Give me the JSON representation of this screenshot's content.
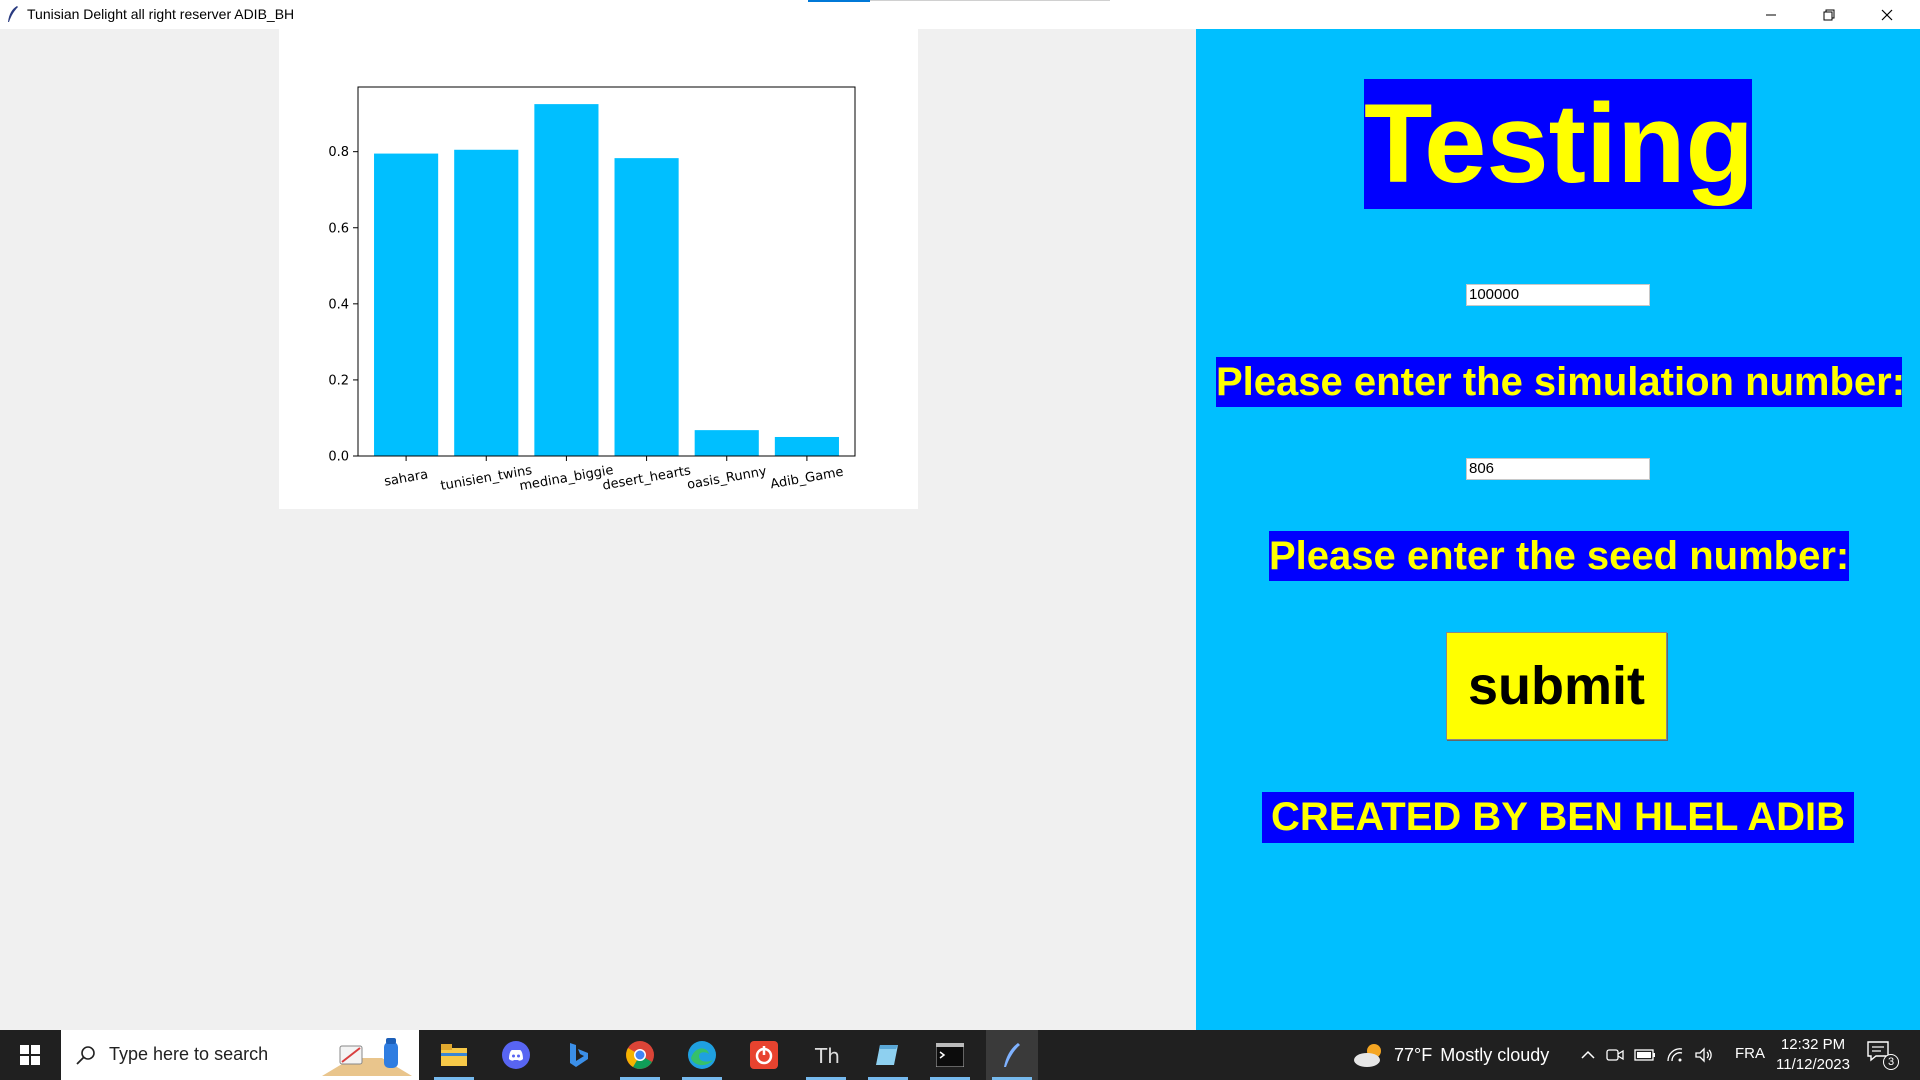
{
  "window": {
    "title": "Tunisian Delight all right reserver ADIB_BH",
    "controls": [
      "minimize-icon",
      "restore-icon",
      "close-icon"
    ]
  },
  "chart_data": {
    "type": "bar",
    "categories": [
      "sahara",
      "tunisien_twins",
      "medina_biggie",
      "desert_hearts",
      "oasis_Runny",
      "Adib_Game"
    ],
    "values": [
      0.795,
      0.805,
      0.925,
      0.783,
      0.068,
      0.05
    ],
    "yticks": [
      "0.0",
      "0.2",
      "0.4",
      "0.6",
      "0.8"
    ],
    "ylim": [
      0,
      0.97
    ],
    "bar_color": "#00bfff",
    "grid": false,
    "xlabel": "",
    "ylabel": "",
    "title": ""
  },
  "right_panel": {
    "heading": "Testing",
    "simulation_input_value": "100000",
    "simulation_label": "Please enter the simulation number:",
    "seed_input_value": "806",
    "seed_label": "Please enter the seed number:",
    "submit_label": "submit",
    "credit": "CREATED BY BEN HLEL ADIB",
    "colors": {
      "panel": "#00bfff",
      "label_bg": "#0000ff",
      "label_text": "#ffff00",
      "button_bg": "#ffff00"
    }
  },
  "taskbar": {
    "search_placeholder": "Type here to search",
    "apps": [
      "file-explorer-icon",
      "discord-icon",
      "bing-icon",
      "chrome-icon",
      "edge-icon",
      "power-app-icon",
      "thonny-icon",
      "notepad-icon",
      "terminal-icon",
      "python-feather-icon"
    ],
    "weather_temp": "77°F",
    "weather_text": "Mostly cloudy",
    "language": "FRA",
    "time": "12:32 PM",
    "date": "11/12/2023",
    "notification_count": "3"
  }
}
